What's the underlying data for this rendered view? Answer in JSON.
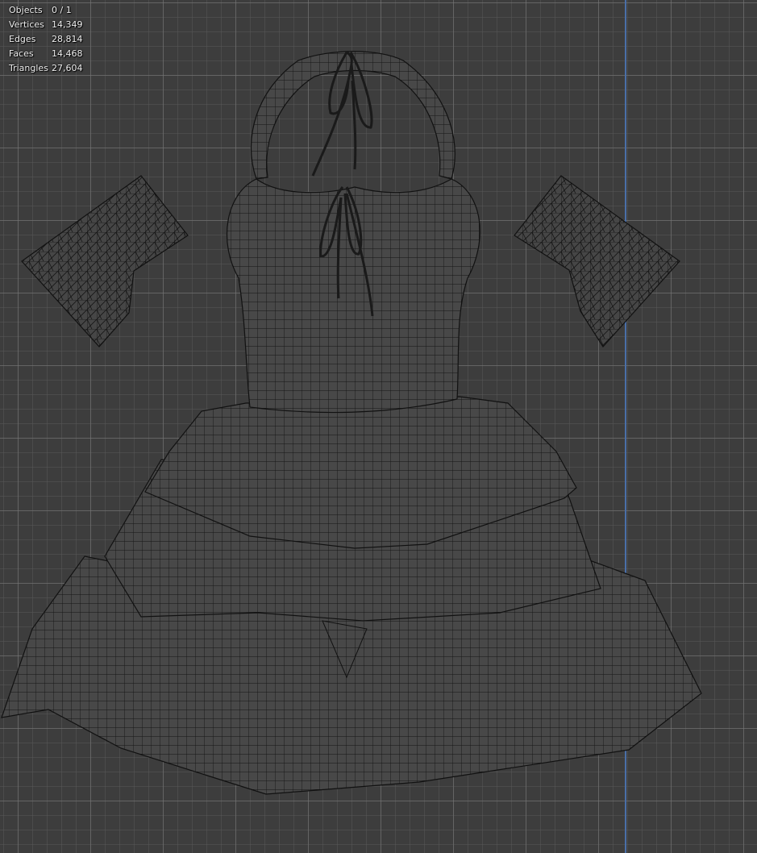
{
  "viewport": {
    "background_color": "#3d3d3d",
    "grid_color": "#5a5a5a",
    "axis_color": "#4a6fa8",
    "wire_color": "#0f0f0f",
    "mesh_fill": "#484848"
  },
  "stats": [
    {
      "label": "Objects",
      "value": "0 / 1"
    },
    {
      "label": "Vertices",
      "value": "14,349"
    },
    {
      "label": "Edges",
      "value": "28,814"
    },
    {
      "label": "Faces",
      "value": "14,468"
    },
    {
      "label": "Triangles",
      "value": "27,604"
    }
  ]
}
